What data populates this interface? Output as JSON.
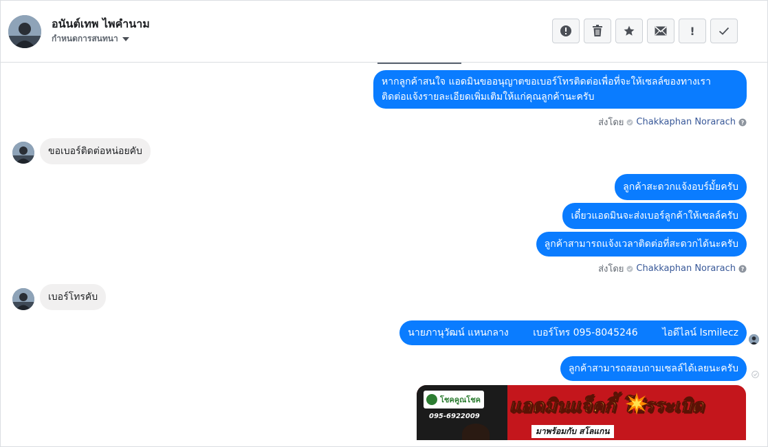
{
  "header": {
    "name": "อนันต์เทพ ไพคำนาม",
    "assign_label": "กำหนดการสนทนา",
    "actions": [
      {
        "name": "spam-button",
        "icon": "alert-circle-icon"
      },
      {
        "name": "delete-button",
        "icon": "trash-icon"
      },
      {
        "name": "star-button",
        "icon": "star-icon"
      },
      {
        "name": "mark-unread-button",
        "icon": "envelope-icon"
      },
      {
        "name": "important-button",
        "icon": "exclamation-icon",
        "glyph": "!"
      },
      {
        "name": "done-button",
        "icon": "checkmark-icon"
      }
    ]
  },
  "messages": {
    "m1_line1": "หากลูกค้าสนใจ แอดมินขออนุญาตขอเบอร์โทรติดต่อเพื่อที่จะให้เซลล์ของทางเรา",
    "m1_line2": "ติดต่อแจ้งรายละเอียดเพิ่มเติมให้แก่คุณลูกค้านะครับ",
    "sent_by_label": "ส่งโดย",
    "sender": "Chakkaphan Norarach",
    "m2": "ขอเบอร์ติดต่อหน่อยคับ",
    "m3": "ลูกค้าสะดวกแจ้งอบร์มั้ยครับ",
    "m4": "เดี๋ยวแอดมินจะส่งเบอร์ลูกค้าให้เซลล์ครับ",
    "m5": "ลูกค้าสามารถแจ้งเวลาติดต่อที่สะดวกได้นะครับ",
    "m6": "เบอร์โทรคับ",
    "m7": "นายภานุวัฒน์ แหนกลาง        เบอร์โทร 095-8045246        ไอดีไลน์ Ismilecz",
    "m8": "ลูกค้าสามารถสอบถามเซลล์ได้เลยนะครับ"
  },
  "banner": {
    "logo_text": "โชคคูณโชค",
    "phone": "095-6922009",
    "title": "แอดมินแจ็คกี้  โปรระเบิด",
    "subtitle": "มาพร้อมกับ สโลแกน"
  },
  "colors": {
    "outgoing_bubble": "#0a7cff",
    "incoming_bubble": "#f1f0f0",
    "sender_link": "#385898"
  }
}
